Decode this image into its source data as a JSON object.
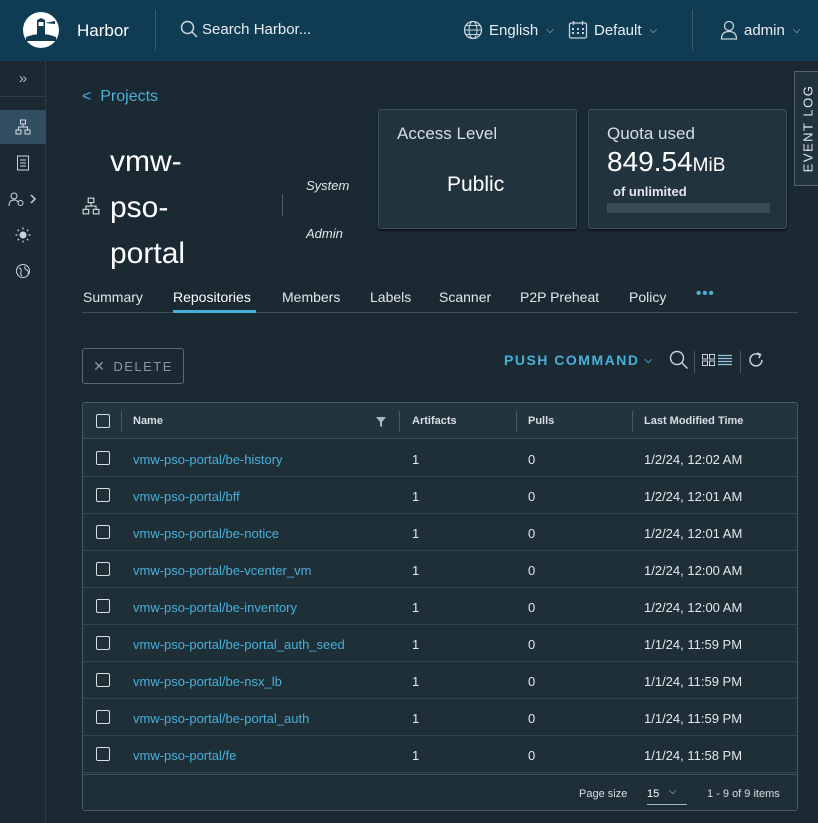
{
  "header": {
    "brand": "Harbor",
    "search_placeholder": "Search Harbor...",
    "language": "English",
    "theme": "Default",
    "user": "admin"
  },
  "breadcrumb": {
    "back": "<",
    "label": "Projects"
  },
  "project": {
    "name_lines": [
      "vmw-",
      "pso-",
      "portal"
    ],
    "role_line1": "System",
    "role_line2": "Admin"
  },
  "access_card": {
    "title": "Access Level",
    "value": "Public"
  },
  "quota_card": {
    "title": "Quota used",
    "amount": "849.54",
    "unit": "MiB",
    "sub": "of unlimited",
    "fill_fraction": 0
  },
  "event_log": "EVENT LOG",
  "tabs": [
    {
      "label": "Summary"
    },
    {
      "label": "Repositories"
    },
    {
      "label": "Members"
    },
    {
      "label": "Labels"
    },
    {
      "label": "Scanner"
    },
    {
      "label": "P2P Preheat"
    },
    {
      "label": "Policy"
    }
  ],
  "tabs_more": "•••",
  "toolbar": {
    "delete_label": "DELETE",
    "push_command_label": "PUSH COMMAND"
  },
  "table": {
    "columns": [
      "Name",
      "Artifacts",
      "Pulls",
      "Last Modified Time"
    ],
    "rows": [
      {
        "name": "vmw-pso-portal/be-history",
        "artifacts": "1",
        "pulls": "0",
        "modified": "1/2/24, 12:02 AM"
      },
      {
        "name": "vmw-pso-portal/bff",
        "artifacts": "1",
        "pulls": "0",
        "modified": "1/2/24, 12:01 AM"
      },
      {
        "name": "vmw-pso-portal/be-notice",
        "artifacts": "1",
        "pulls": "0",
        "modified": "1/2/24, 12:01 AM"
      },
      {
        "name": "vmw-pso-portal/be-vcenter_vm",
        "artifacts": "1",
        "pulls": "0",
        "modified": "1/2/24, 12:00 AM"
      },
      {
        "name": "vmw-pso-portal/be-inventory",
        "artifacts": "1",
        "pulls": "0",
        "modified": "1/2/24, 12:00 AM"
      },
      {
        "name": "vmw-pso-portal/be-portal_auth_seed",
        "artifacts": "1",
        "pulls": "0",
        "modified": "1/1/24, 11:59 PM"
      },
      {
        "name": "vmw-pso-portal/be-nsx_lb",
        "artifacts": "1",
        "pulls": "0",
        "modified": "1/1/24, 11:59 PM"
      },
      {
        "name": "vmw-pso-portal/be-portal_auth",
        "artifacts": "1",
        "pulls": "0",
        "modified": "1/1/24, 11:59 PM"
      },
      {
        "name": "vmw-pso-portal/fe",
        "artifacts": "1",
        "pulls": "0",
        "modified": "1/1/24, 11:58 PM"
      }
    ]
  },
  "footer": {
    "page_size_label": "Page size",
    "page_size": "15",
    "range": "1 - 9 of 9 items"
  },
  "colors": {
    "header_bg": "#0f3b53",
    "accent": "#49afd9",
    "page_bg": "#1b2a32"
  }
}
